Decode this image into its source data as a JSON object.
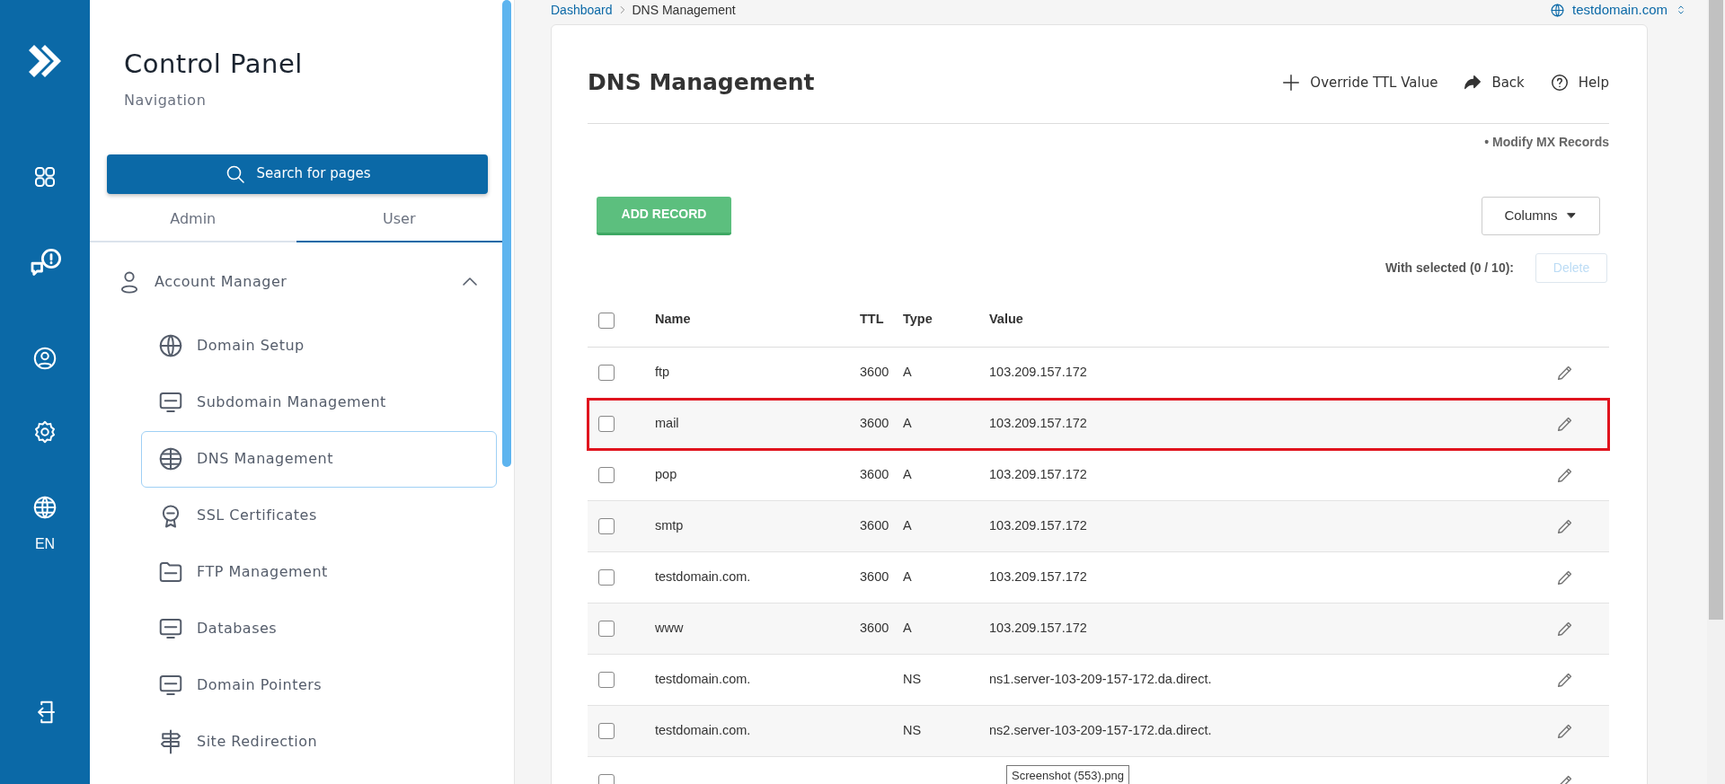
{
  "rail": [
    {
      "kind": "logo"
    },
    {
      "kind": "grid"
    },
    {
      "kind": "chat"
    },
    {
      "kind": "user"
    },
    {
      "kind": "gear"
    },
    {
      "kind": "globe",
      "label": "EN"
    },
    {
      "kind": "logout"
    }
  ],
  "sidebar": {
    "title": "Control Panel",
    "subtitle": "Navigation",
    "search": "Search for pages",
    "tabs": [
      {
        "label": "Admin",
        "selected": false
      },
      {
        "label": "User",
        "selected": true
      }
    ],
    "group": {
      "label": "Account Manager",
      "expanded": true,
      "items": [
        {
          "label": "Domain Setup",
          "kind": "www",
          "selected": false
        },
        {
          "label": "Subdomain Management",
          "kind": "monitor",
          "selected": false
        },
        {
          "label": "DNS Management",
          "kind": "dns",
          "selected": true
        },
        {
          "label": "SSL Certificates",
          "kind": "ssl",
          "selected": false
        },
        {
          "label": "FTP Management",
          "kind": "folder",
          "selected": false
        },
        {
          "label": "Databases",
          "kind": "sql",
          "selected": false
        },
        {
          "label": "Domain Pointers",
          "kind": "monitor",
          "selected": false
        },
        {
          "label": "Site Redirection",
          "kind": "sign",
          "selected": false
        }
      ]
    }
  },
  "breadcrumb": [
    {
      "label": "Dashboard",
      "link": true
    },
    {
      "label": "DNS Management",
      "link": false
    }
  ],
  "domain": "testdomain.com",
  "page": {
    "title": "DNS Management",
    "actions": [
      {
        "label": "Override TTL Value",
        "kind": "plus"
      },
      {
        "label": "Back",
        "kind": "share"
      },
      {
        "label": "Help",
        "kind": "help"
      }
    ],
    "modify_link": "• Modify MX Records",
    "add_button": "ADD RECORD",
    "columns_button": "Columns",
    "with_selected": "With selected (0 / 10):",
    "delete_button": "Delete"
  },
  "table": {
    "select_all_checked": false,
    "columns": [
      "Name",
      "TTL",
      "Type",
      "Value"
    ],
    "rows": [
      {
        "name": "ftp",
        "ttl": "3600",
        "type": "A",
        "value": "103.209.157.172",
        "checked": false,
        "highlighted": false
      },
      {
        "name": "mail",
        "ttl": "3600",
        "type": "A",
        "value": "103.209.157.172",
        "checked": false,
        "highlighted": true
      },
      {
        "name": "pop",
        "ttl": "3600",
        "type": "A",
        "value": "103.209.157.172",
        "checked": false,
        "highlighted": false
      },
      {
        "name": "smtp",
        "ttl": "3600",
        "type": "A",
        "value": "103.209.157.172",
        "checked": false,
        "highlighted": false
      },
      {
        "name": "testdomain.com.",
        "ttl": "3600",
        "type": "A",
        "value": "103.209.157.172",
        "checked": false,
        "highlighted": false
      },
      {
        "name": "www",
        "ttl": "3600",
        "type": "A",
        "value": "103.209.157.172",
        "checked": false,
        "highlighted": false
      },
      {
        "name": "testdomain.com.",
        "ttl": "",
        "type": "NS",
        "value": "ns1.server-103-209-157-172.da.direct.",
        "checked": false,
        "highlighted": false
      },
      {
        "name": "testdomain.com.",
        "ttl": "",
        "type": "NS",
        "value": "ns2.server-103-209-157-172.da.direct.",
        "checked": false,
        "highlighted": false
      },
      {
        "checked": false,
        "highlighted": false
      }
    ]
  },
  "tooltip": "Screenshot (553).png"
}
